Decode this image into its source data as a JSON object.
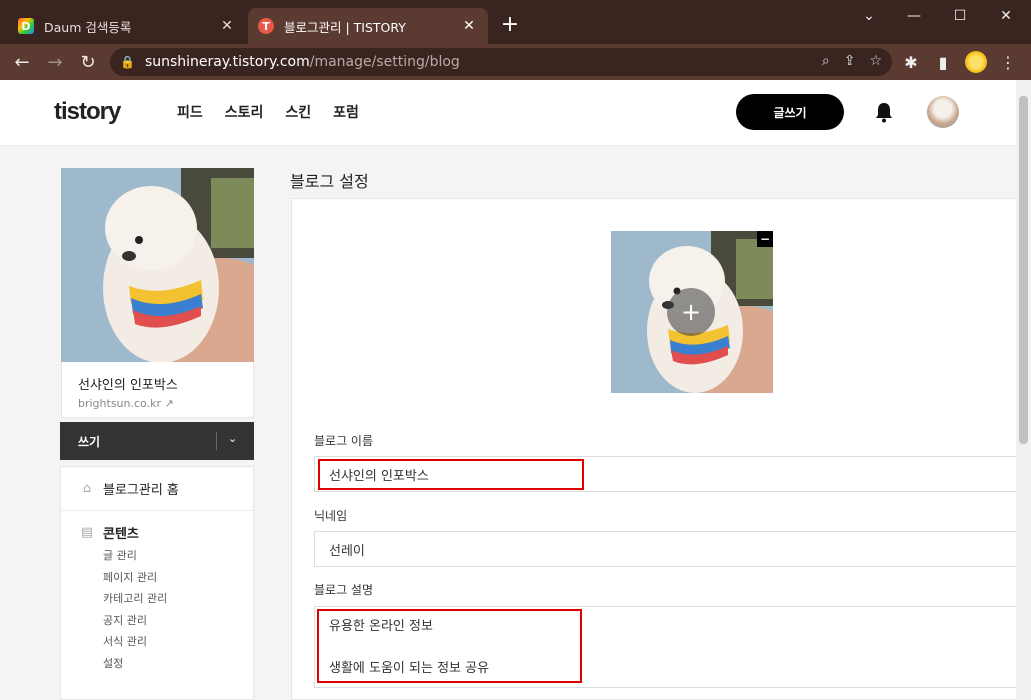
{
  "browser": {
    "tabs": [
      {
        "title": "Daum 검색등록",
        "favicon": "D"
      },
      {
        "title": "블로그관리 | TISTORY",
        "favicon": "T"
      }
    ],
    "new_tab_symbol": "+",
    "url_host": "sunshineray.tistory.com",
    "url_path": "/manage/setting/blog"
  },
  "header": {
    "logo": "tistory",
    "nav": [
      "피드",
      "스토리",
      "스킨",
      "포럼"
    ],
    "write_button": "글쓰기"
  },
  "sidebar": {
    "blog_name": "선샤인의 인포박스",
    "blog_url": "brightsun.co.kr",
    "write_label": "쓰기",
    "home_label": "블로그관리 홈",
    "content_section": "콘텐츠",
    "content_items": [
      "글 관리",
      "페이지 관리",
      "카테고리 관리",
      "공지 관리",
      "서식 관리",
      "설정"
    ]
  },
  "main": {
    "page_title": "블로그 설정",
    "blog_name_label": "블로그 이름",
    "blog_name_value": "선샤인의 인포박스",
    "nickname_label": "닉네임",
    "nickname_value": "선레이",
    "description_label": "블로그 설명",
    "description_line1": "유용한 온라인 정보",
    "description_line2": "생활에 도움이 되는 정보 공유"
  },
  "colors": {
    "titlebar": "#3a2420",
    "toolbar": "#5b3a32",
    "highlight": "#e00000",
    "tistory_accent": "#ea5847"
  }
}
